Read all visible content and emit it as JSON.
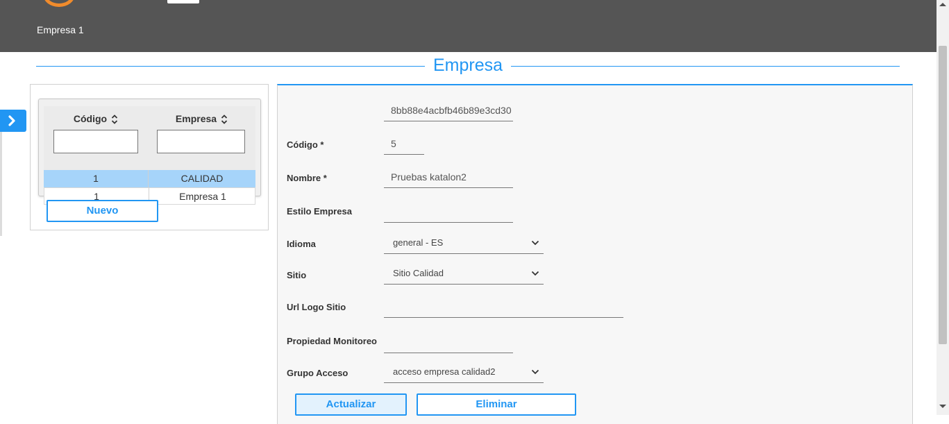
{
  "header": {
    "company": "Empresa 1"
  },
  "section_title": "Empresa",
  "table": {
    "columns": [
      "Código",
      "Empresa"
    ],
    "rows": [
      {
        "codigo": "1",
        "empresa": "CALIDAD",
        "selected": true
      },
      {
        "codigo": "1",
        "empresa": "Empresa 1",
        "selected": false
      }
    ]
  },
  "buttons": {
    "nuevo": "Nuevo",
    "actualizar": "Actualizar",
    "eliminar": "Eliminar"
  },
  "form": {
    "id_value": "8bb88e4acbfb46b89e3cd30",
    "codigo_label": "Código *",
    "codigo_value": "5",
    "nombre_label": "Nombre *",
    "nombre_value": "Pruebas katalon2",
    "estilo_label": "Estilo Empresa",
    "estilo_value": "",
    "idioma_label": "Idioma",
    "idioma_value": "general - ES",
    "sitio_label": "Sitio",
    "sitio_value": "Sitio Calidad",
    "url_logo_label": "Url Logo Sitio",
    "url_logo_value": "",
    "propiedad_label": "Propiedad Monitoreo",
    "propiedad_value": "",
    "grupo_label": "Grupo Acceso",
    "grupo_value": "acceso empresa calidad2"
  },
  "colors": {
    "accent": "#2196f3",
    "header_bg": "#555555",
    "selected_row": "#a6d4fa"
  }
}
